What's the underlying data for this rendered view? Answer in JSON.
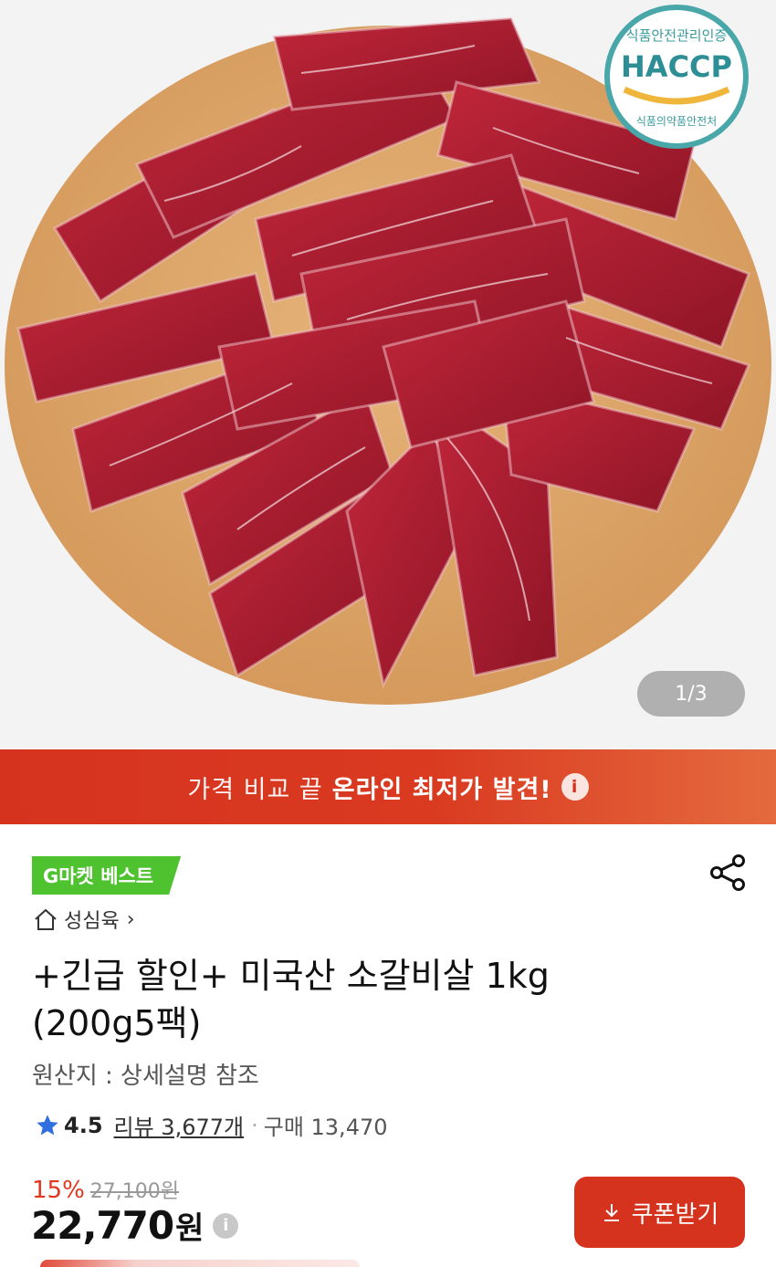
{
  "hero": {
    "image_alt": "product-photo-beef-on-wooden-board",
    "haccp_top": "식품안전관리인증",
    "haccp_main": "HACCP",
    "haccp_bottom": "식품의약품안전처",
    "counter": "1/3"
  },
  "banner": {
    "light_text": "가격 비교 끝",
    "strong_text": "온라인 최저가 발견!",
    "info_glyph": "i"
  },
  "product": {
    "badge": "G마켓 베스트",
    "store_name": "성심육",
    "title": "+긴급 할인+ 미국산 소갈비살 1kg (200g5팩)",
    "origin": "원산지 : 상세설명 참조",
    "rating": "4.5",
    "review_text": "리뷰 3,677개",
    "purchase_text": "구매 13,470",
    "discount_rate": "15%",
    "original_price": "27,100원",
    "price": "22,770",
    "price_unit": "원",
    "price_info_glyph": "i"
  },
  "actions": {
    "coupon_label": "쿠폰받기"
  },
  "colors": {
    "accent": "#d6331f",
    "badge_green": "#4fc230",
    "star_blue": "#2f6fe0"
  }
}
